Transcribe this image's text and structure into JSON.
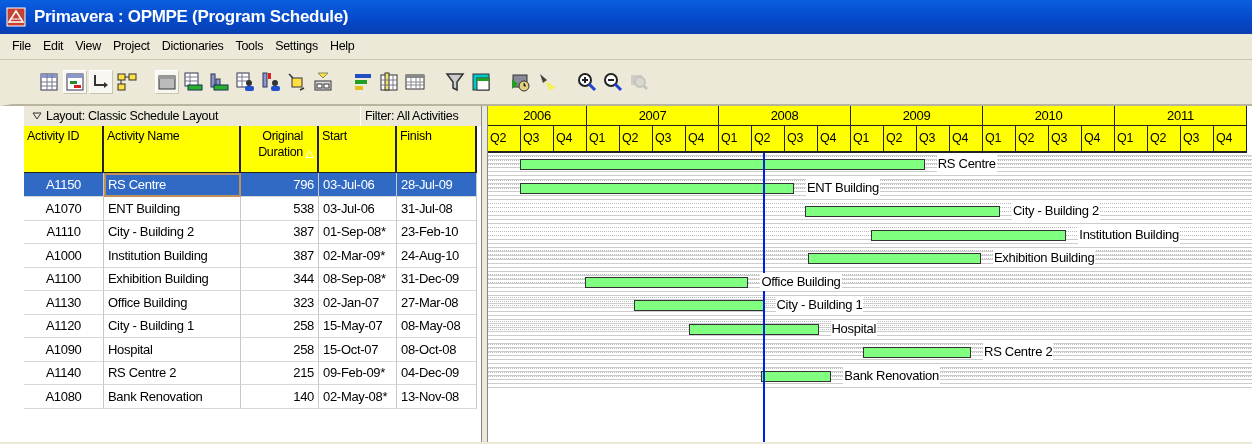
{
  "window": {
    "title": "Primavera : OPMPE (Program Schedule)"
  },
  "menu": [
    "File",
    "Edit",
    "View",
    "Project",
    "Dictionaries",
    "Tools",
    "Settings",
    "Help"
  ],
  "toolbar": [
    {
      "kind": "table",
      "pressed": false
    },
    {
      "kind": "gantt",
      "pressed": true
    },
    {
      "kind": "relationship",
      "pressed": true
    },
    {
      "kind": "network",
      "pressed": false
    },
    {
      "kind": "sep"
    },
    {
      "kind": "window",
      "pressed": true
    },
    {
      "kind": "table-bar",
      "pressed": false
    },
    {
      "kind": "histogram",
      "pressed": false
    },
    {
      "kind": "table-person",
      "pressed": false
    },
    {
      "kind": "histogram-person",
      "pressed": false
    },
    {
      "kind": "move",
      "pressed": false
    },
    {
      "kind": "tray",
      "pressed": false
    },
    {
      "kind": "sep"
    },
    {
      "kind": "bars",
      "pressed": false
    },
    {
      "kind": "columns",
      "pressed": false
    },
    {
      "kind": "grid",
      "pressed": false
    },
    {
      "kind": "sep"
    },
    {
      "kind": "filter",
      "pressed": false
    },
    {
      "kind": "layout",
      "pressed": false
    },
    {
      "kind": "sep"
    },
    {
      "kind": "schedule",
      "pressed": false
    },
    {
      "kind": "spotlight",
      "pressed": false
    },
    {
      "kind": "sep"
    },
    {
      "kind": "zoom-in",
      "pressed": false,
      "disabled": false
    },
    {
      "kind": "zoom-out",
      "pressed": false,
      "disabled": false
    },
    {
      "kind": "zoom-fit",
      "pressed": false,
      "disabled": true
    }
  ],
  "layout_bar": {
    "layout": "Layout: Classic Schedule Layout",
    "filter": "Filter: All Activities"
  },
  "table": {
    "columns": [
      {
        "label": "Activity ID",
        "sorted": false
      },
      {
        "label": "Activity Name",
        "sorted": false
      },
      {
        "label": "Original Duration",
        "sorted": true
      },
      {
        "label": "Start",
        "sorted": false
      },
      {
        "label": "Finish",
        "sorted": false
      }
    ],
    "rows": [
      {
        "cells": [
          "A1150",
          "RS Centre",
          "796",
          "03-Jul-06",
          "28-Jul-09"
        ],
        "selected": true,
        "bar_label": "RS Centre"
      },
      {
        "cells": [
          "A1070",
          "ENT Building",
          "538",
          "03-Jul-06",
          "31-Jul-08"
        ],
        "selected": false,
        "bar_label": "ENT Building"
      },
      {
        "cells": [
          "A1110",
          "City - Building 2",
          "387",
          "01-Sep-08*",
          "23-Feb-10"
        ],
        "selected": false,
        "bar_label": "City - Building 2"
      },
      {
        "cells": [
          "A1000",
          "Institution Building",
          "387",
          "02-Mar-09*",
          "24-Aug-10"
        ],
        "selected": false,
        "bar_label": "Institution Building"
      },
      {
        "cells": [
          "A1100",
          "Exhibition Building",
          "344",
          "08-Sep-08*",
          "31-Dec-09"
        ],
        "selected": false,
        "bar_label": "Exhibition Building"
      },
      {
        "cells": [
          "A1130",
          "Office Building",
          "323",
          "02-Jan-07",
          "27-Mar-08"
        ],
        "selected": false,
        "bar_label": "Office Building"
      },
      {
        "cells": [
          "A1120",
          "City - Building 1",
          "258",
          "15-May-07",
          "08-May-08"
        ],
        "selected": false,
        "bar_label": "City - Building 1"
      },
      {
        "cells": [
          "A1090",
          "Hospital",
          "258",
          "15-Oct-07",
          "08-Oct-08"
        ],
        "selected": false,
        "bar_label": "Hospital"
      },
      {
        "cells": [
          "A1140",
          "RS Centre 2",
          "215",
          "09-Feb-09*",
          "04-Dec-09"
        ],
        "selected": false,
        "bar_label": "RS Centre 2"
      },
      {
        "cells": [
          "A1080",
          "Bank Renovation",
          "140",
          "02-May-08*",
          "13-Nov-08"
        ],
        "selected": false,
        "bar_label": "Bank Renovation"
      }
    ]
  },
  "gantt": {
    "years": [
      {
        "label": "2006",
        "quarters": [
          "Q2",
          "Q3",
          "Q4"
        ]
      },
      {
        "label": "2007",
        "quarters": [
          "Q1",
          "Q2",
          "Q3",
          "Q4"
        ]
      },
      {
        "label": "2008",
        "quarters": [
          "Q1",
          "Q2",
          "Q3",
          "Q4"
        ]
      },
      {
        "label": "2009",
        "quarters": [
          "Q1",
          "Q2",
          "Q3",
          "Q4"
        ]
      },
      {
        "label": "2010",
        "quarters": [
          "Q1",
          "Q2",
          "Q3",
          "Q4"
        ]
      },
      {
        "label": "2011",
        "quarters": [
          "Q1",
          "Q2",
          "Q3",
          "Q4"
        ]
      }
    ]
  }
}
